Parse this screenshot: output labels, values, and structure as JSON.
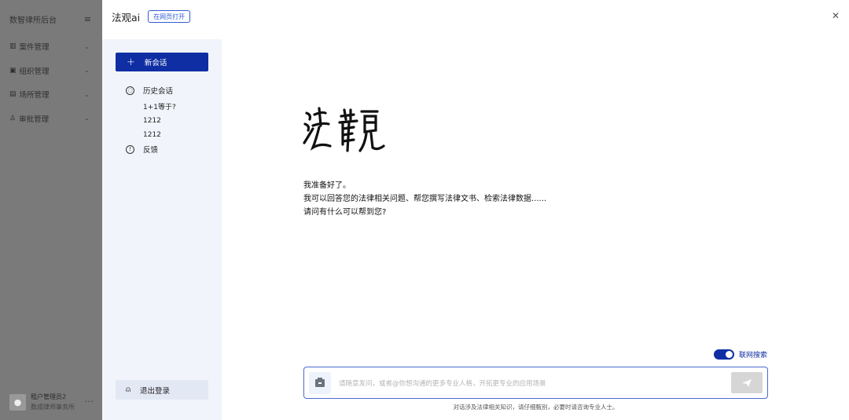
{
  "background_app": {
    "title": "数智律所后台",
    "menu_icon": "menu-icon",
    "nav": [
      {
        "label": "案件管理",
        "icon": "case-icon"
      },
      {
        "label": "组织管理",
        "icon": "org-icon"
      },
      {
        "label": "场所管理",
        "icon": "building-icon"
      },
      {
        "label": "审批管理",
        "icon": "approval-icon"
      }
    ],
    "user": {
      "name": "租户管理员2",
      "org": "数成律师事务所"
    }
  },
  "panel": {
    "title": "法观ai",
    "open_web": "在网页打开",
    "close_icon": "close-icon"
  },
  "sidebar": {
    "new_chat": "新会话",
    "history_label": "历史会话",
    "history": [
      "1+1等于?",
      "1212",
      "1212"
    ],
    "feedback": "反馈",
    "logout": "退出登录"
  },
  "chat": {
    "logo_text": "法觀",
    "welcome": [
      "我准备好了。",
      "我可以回答您的法律相关问题、帮您撰写法律文书、检索法律数据......",
      "请问有什么可以帮到您?"
    ],
    "web_search": "联网搜索",
    "web_search_on": true,
    "placeholder": "请随意发问，或者@你想沟通的更多专业人格，开拓更专业的应用场景",
    "disclaimer": "对话涉及法律相关知识，请仔细甄别，必要时请咨询专业人士。"
  },
  "colors": {
    "accent": "#0f2ea3",
    "overlay": "#808080"
  }
}
